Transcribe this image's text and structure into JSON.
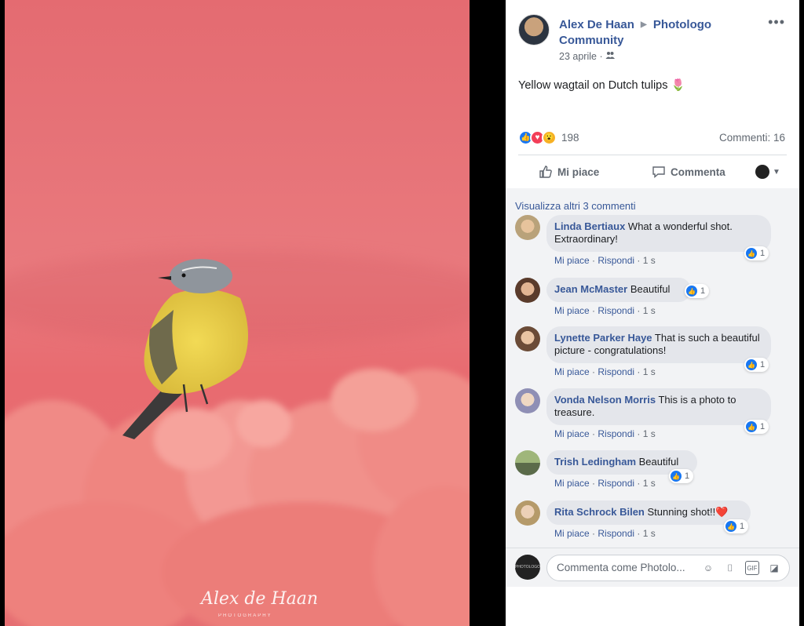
{
  "post": {
    "author": "Alex De Haan",
    "group": "Photologo Community",
    "date": "23 aprile",
    "caption": "Yellow wagtail on Dutch tulips 🌷",
    "reaction_count": "198",
    "comment_count": "Commenti: 16"
  },
  "actions": {
    "like": "Mi piace",
    "comment": "Commenta"
  },
  "photo": {
    "signature": "Alex de Haan",
    "signature_sub": "PHOTOGRAPHY"
  },
  "comments_section": {
    "view_more": "Visualizza altri 3 commenti",
    "like_label": "Mi piace",
    "reply_label": "Rispondi",
    "items": [
      {
        "name": "Linda Bertiaux",
        "text": "What a wonderful shot. Extraordinary!",
        "time": "1 s",
        "likes": "1"
      },
      {
        "name": "Jean McMaster",
        "text": "Beautiful",
        "time": "1 s",
        "likes": "1"
      },
      {
        "name": "Lynette Parker Haye",
        "text": "That is such a beautiful picture - congratulations!",
        "time": "1 s",
        "likes": "1"
      },
      {
        "name": "Vonda Nelson Morris",
        "text": "This is a photo to treasure.",
        "time": "1 s",
        "likes": "1"
      },
      {
        "name": "Trish Ledingham",
        "text": "Beautiful",
        "time": "1 s",
        "likes": "1"
      },
      {
        "name": "Rita Schrock Bilen",
        "text": "Stunning shot!!❤️",
        "time": "1 s",
        "likes": "1"
      }
    ]
  },
  "composer": {
    "placeholder": "Commenta come Photolo...",
    "avatar_text": "PHOTOLOGO"
  },
  "colors": {
    "link": "#385898",
    "like_blue": "#1877f2",
    "tulip_pink": "#e8767b"
  }
}
